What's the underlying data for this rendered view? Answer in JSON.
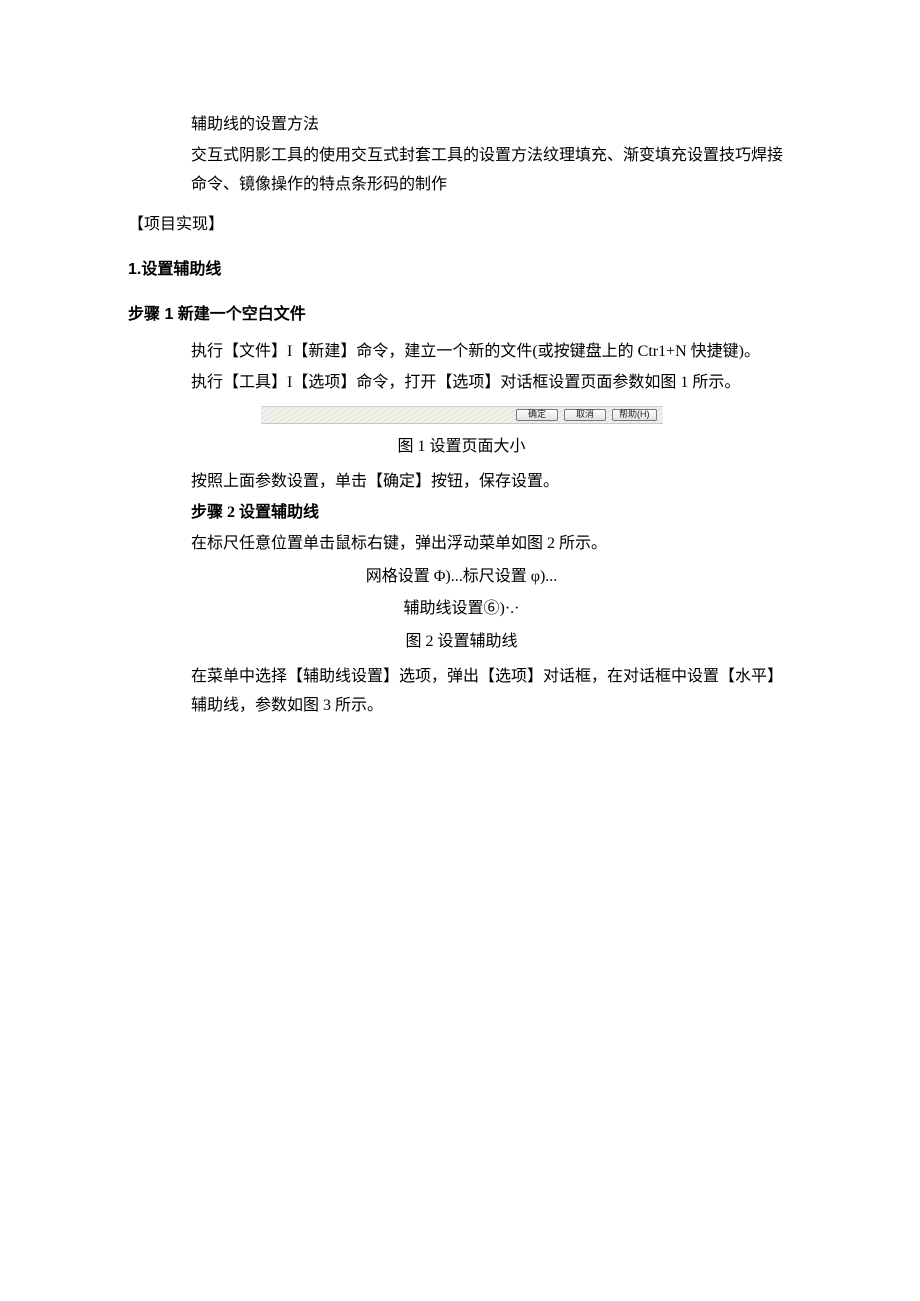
{
  "bullet1": "辅助线的设置方法",
  "bullet2": "交互式阴影工具的使用交互式封套工具的设置方法纹理填充、渐变填充设置技巧焊接命令、镜像操作的特点条形码的制作",
  "sectionHeader": "【项目实现】",
  "h1": "1.设置辅助线",
  "h2": "步骤 1 新建一个空白文件",
  "p1": "执行【文件】I【新建】命令，建立一个新的文件(或按键盘上的 Ctr1+N 快捷键)。",
  "p2": "执行【工具】I【选项】命令，打开【选项】对话框设置页面参数如图 1 所示。",
  "dialogButtons": {
    "ok": "确定",
    "cancel": "取消",
    "help": "帮助(H)"
  },
  "caption1": "图 1 设置页面大小",
  "p3": "按照上面参数设置，单击【确定】按钮，保存设置。",
  "h3": "步骤 2 设置辅助线",
  "p4": "在标尺任意位置单击鼠标右键，弹出浮动菜单如图 2 所示。",
  "menuLine1": "网格设置 Φ)...标尺设置 φ)...",
  "menuLine2": "辅助线设置⑥)·.·",
  "caption2": "图 2 设置辅助线",
  "p5": "在菜单中选择【辅助线设置】选项，弹出【选项】对话框，在对话框中设置【水平】辅助线，参数如图 3 所示。"
}
